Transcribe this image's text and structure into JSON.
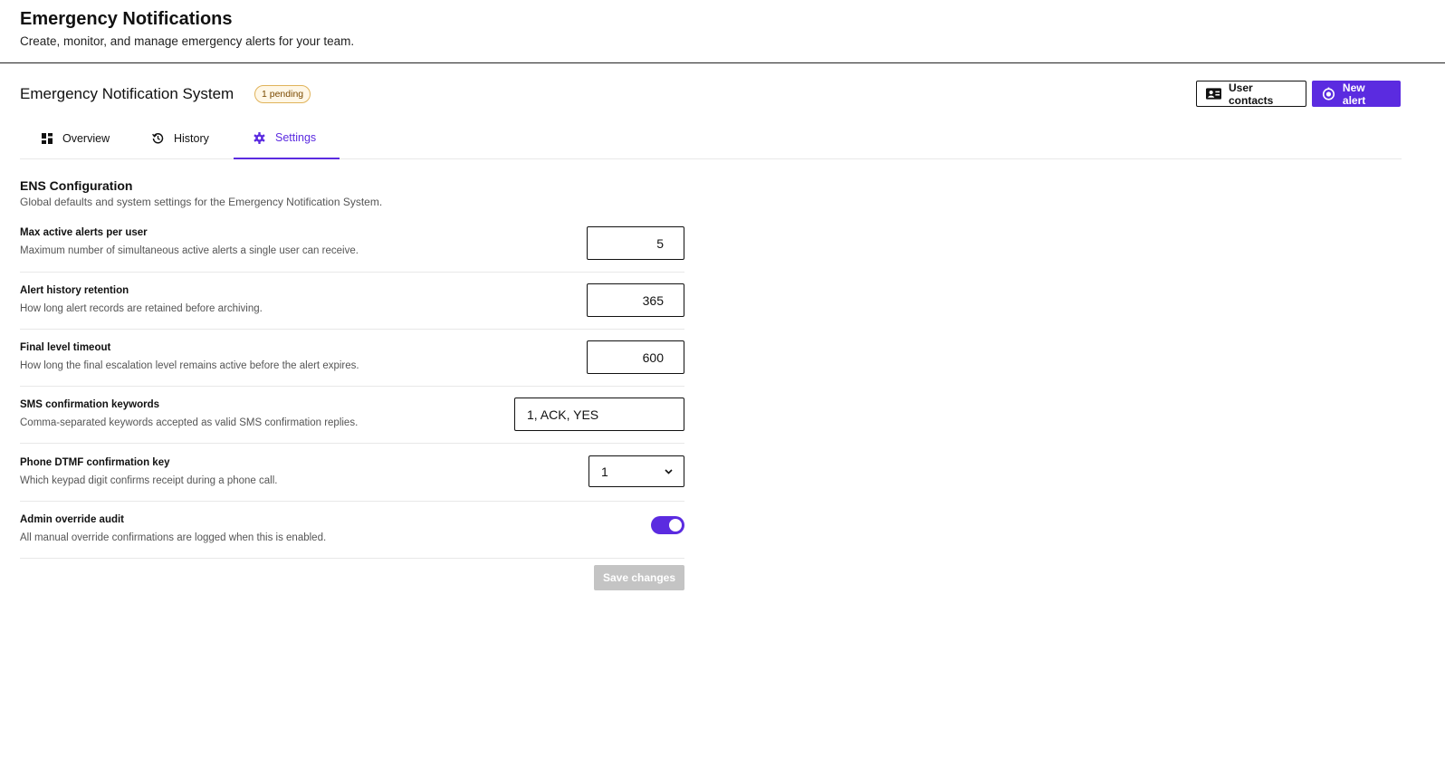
{
  "header": {
    "title": "Emergency Notifications",
    "subtitle": "Create, monitor, and manage emergency alerts for your team."
  },
  "system": {
    "title": "Emergency Notification System",
    "badge": "1 pending"
  },
  "actions": {
    "user_contacts": "User contacts",
    "new_alert": "New alert"
  },
  "tabs": [
    {
      "label": "Overview",
      "icon": "dashboard-icon"
    },
    {
      "label": "History",
      "icon": "history-icon"
    },
    {
      "label": "Settings",
      "icon": "gear-icon",
      "active": true
    }
  ],
  "config": {
    "title": "ENS Configuration",
    "description": "Global defaults and system settings for the Emergency Notification System.",
    "settings": [
      {
        "label": "Max active alerts per user",
        "description": "Maximum number of simultaneous active alerts a single user can receive.",
        "value": "5"
      },
      {
        "label": "Alert history retention",
        "description": "How long alert records are retained before archiving.",
        "value": "365"
      },
      {
        "label": "Final level timeout",
        "description": "How long the final escalation level remains active before the alert expires.",
        "value": "600"
      },
      {
        "label": "SMS confirmation keywords",
        "description": "Comma-separated keywords accepted as valid SMS confirmation replies.",
        "value": "1, ACK, YES"
      },
      {
        "label": "Phone DTMF confirmation key",
        "description": "Which keypad digit confirms receipt during a phone call.",
        "value": "1"
      },
      {
        "label": "Admin override audit",
        "description": "All manual override confirmations are logged when this is enabled.",
        "enabled": true
      }
    ],
    "save_label": "Save changes"
  },
  "colors": {
    "accent": "#5b2be0",
    "badge_border": "#e0b35a",
    "disabled": "#c4c4c4"
  }
}
